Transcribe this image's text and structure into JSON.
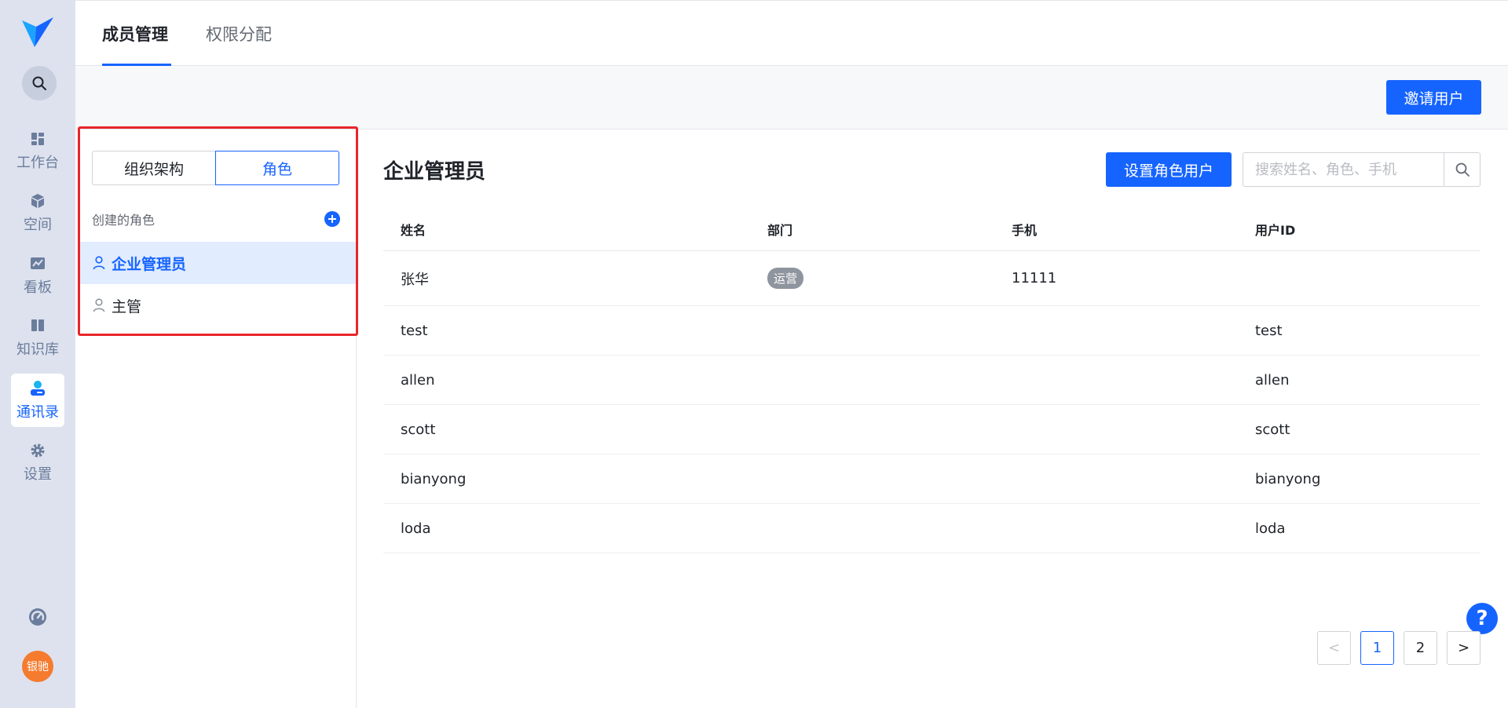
{
  "rail": {
    "nav": [
      {
        "label": "工作台",
        "icon": "grid-icon"
      },
      {
        "label": "空间",
        "icon": "cube-icon"
      },
      {
        "label": "看板",
        "icon": "chart-icon"
      },
      {
        "label": "知识库",
        "icon": "book-icon"
      },
      {
        "label": "通讯录",
        "icon": "contacts-icon",
        "active": true
      },
      {
        "label": "设置",
        "icon": "gear-icon"
      }
    ],
    "avatar_text": "银驰"
  },
  "tabs": [
    {
      "label": "成员管理",
      "active": true
    },
    {
      "label": "权限分配",
      "active": false
    }
  ],
  "actions": {
    "invite_label": "邀请用户"
  },
  "left_panel": {
    "segments": [
      {
        "label": "组织架构",
        "active": false
      },
      {
        "label": "角色",
        "active": true
      }
    ],
    "roles_header": "创建的角色",
    "roles": [
      {
        "label": "企业管理员",
        "active": true
      },
      {
        "label": "主管",
        "active": false
      }
    ]
  },
  "main": {
    "title": "企业管理员",
    "set_role_users_label": "设置角色用户",
    "search_placeholder": "搜索姓名、角色、手机",
    "columns": [
      "姓名",
      "部门",
      "手机",
      "用户ID"
    ],
    "rows": [
      {
        "name": "张华",
        "dept": "运营",
        "phone": "11111",
        "uid": ""
      },
      {
        "name": "test",
        "dept": "",
        "phone": "",
        "uid": "test"
      },
      {
        "name": "allen",
        "dept": "",
        "phone": "",
        "uid": "allen"
      },
      {
        "name": "scott",
        "dept": "",
        "phone": "",
        "uid": "scott"
      },
      {
        "name": "bianyong",
        "dept": "",
        "phone": "",
        "uid": "bianyong"
      },
      {
        "name": "loda",
        "dept": "",
        "phone": "",
        "uid": "loda"
      }
    ],
    "pagination": {
      "prev": "<",
      "pages": [
        "1",
        "2"
      ],
      "current": "1",
      "next": ">"
    },
    "help_label": "?"
  },
  "colors": {
    "accent": "#1664ff",
    "rail_bg": "#dde2ee",
    "highlight_frame": "#e8262a",
    "avatar_bg": "#f57b2f"
  }
}
